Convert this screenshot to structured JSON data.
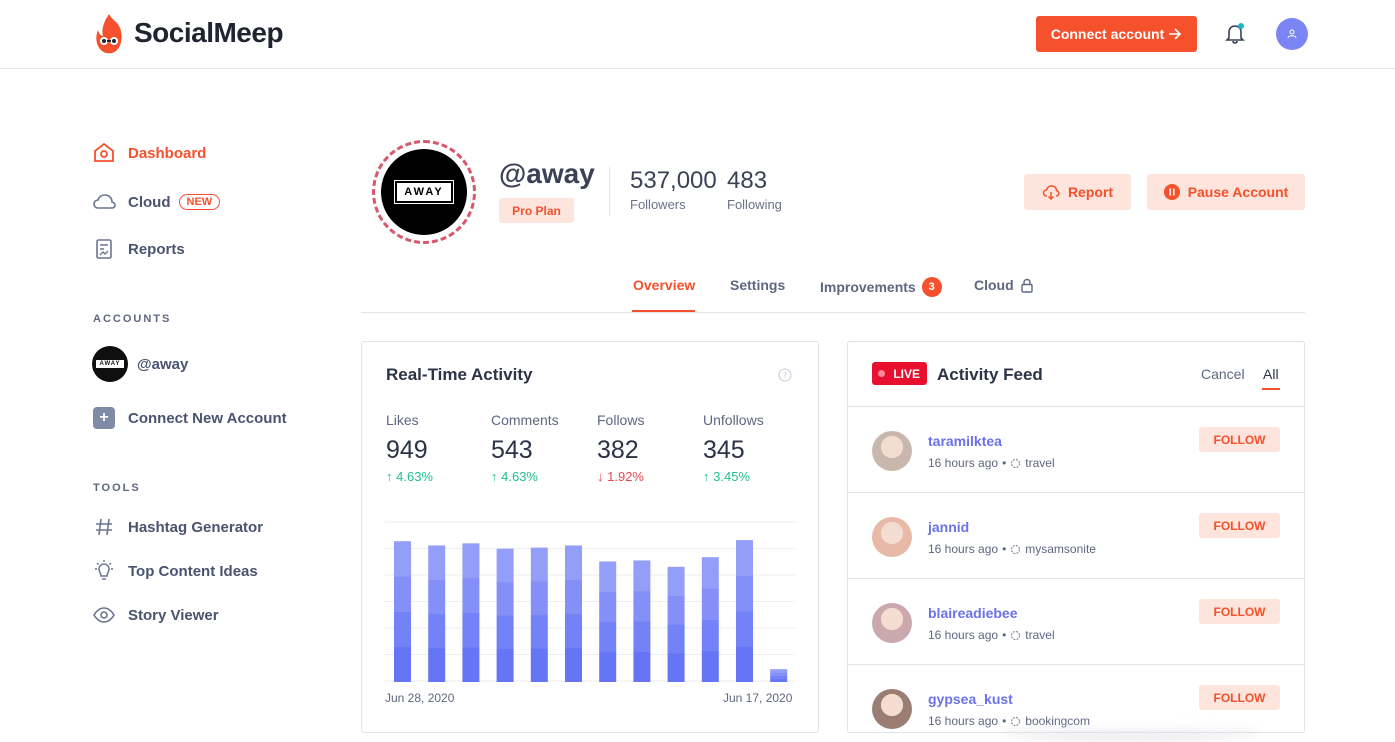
{
  "app": {
    "name": "SocialMeep",
    "connect_label": "Connect account",
    "brand_color": "#f4512c"
  },
  "sidebar": {
    "nav": [
      {
        "label": "Dashboard",
        "icon": "home-icon",
        "active": true
      },
      {
        "label": "Cloud",
        "icon": "cloud-icon",
        "badge": "NEW"
      },
      {
        "label": "Reports",
        "icon": "report-icon"
      }
    ],
    "accounts_label": "ACCOUNTS",
    "accounts": [
      {
        "label": "@away",
        "logo": "AWAY"
      }
    ],
    "connect_new_label": "Connect New Account",
    "tools_label": "TOOLS",
    "tools": [
      {
        "label": "Hashtag Generator",
        "icon": "hashtag-icon"
      },
      {
        "label": "Top Content Ideas",
        "icon": "lightbulb-icon"
      },
      {
        "label": "Story Viewer",
        "icon": "eye-icon"
      }
    ]
  },
  "profile": {
    "logo_text": "AWAY",
    "handle": "@away",
    "plan": "Pro Plan",
    "followers": "537,000",
    "followers_label": "Followers",
    "following": "483",
    "following_label": "Following",
    "report_label": "Report",
    "pause_label": "Pause Account"
  },
  "tabs": [
    {
      "label": "Overview",
      "active": true
    },
    {
      "label": "Settings"
    },
    {
      "label": "Improvements",
      "count": "3"
    },
    {
      "label": "Cloud",
      "icon": "lock-icon"
    }
  ],
  "activity": {
    "title": "Real-Time Activity",
    "metrics": [
      {
        "label": "Likes",
        "value": "949",
        "change": "4.63%",
        "direction": "up"
      },
      {
        "label": "Comments",
        "value": "543",
        "change": "4.63%",
        "direction": "up"
      },
      {
        "label": "Follows",
        "value": "382",
        "change": "1.92%",
        "direction": "down"
      },
      {
        "label": "Unfollows",
        "value": "345",
        "change": "3.45%",
        "direction": "up"
      }
    ],
    "date_start": "Jun 28, 2020",
    "date_end": "Jun 17, 2020"
  },
  "chart_data": {
    "type": "bar",
    "title": "",
    "series": [
      {
        "values": [
          132,
          128,
          130,
          125,
          126,
          128,
          113,
          114,
          108,
          117,
          133,
          12
        ]
      }
    ],
    "ylim": [
      0,
      150
    ],
    "grid": true,
    "bar_color": "#7a86f9"
  },
  "feed": {
    "live_label": "LIVE",
    "title": "Activity Feed",
    "filters": [
      "Cancel",
      "All"
    ],
    "follow_label": "FOLLOW",
    "items": [
      {
        "user": "taramilktea",
        "time": "16 hours ago",
        "tag": "travel"
      },
      {
        "user": "jannid",
        "time": "16 hours ago",
        "tag": "mysamsonite"
      },
      {
        "user": "blaireadiebee",
        "time": "16 hours ago",
        "tag": "travel"
      },
      {
        "user": "gypsea_kust",
        "time": "16 hours ago",
        "tag": "bookingcom"
      }
    ]
  }
}
